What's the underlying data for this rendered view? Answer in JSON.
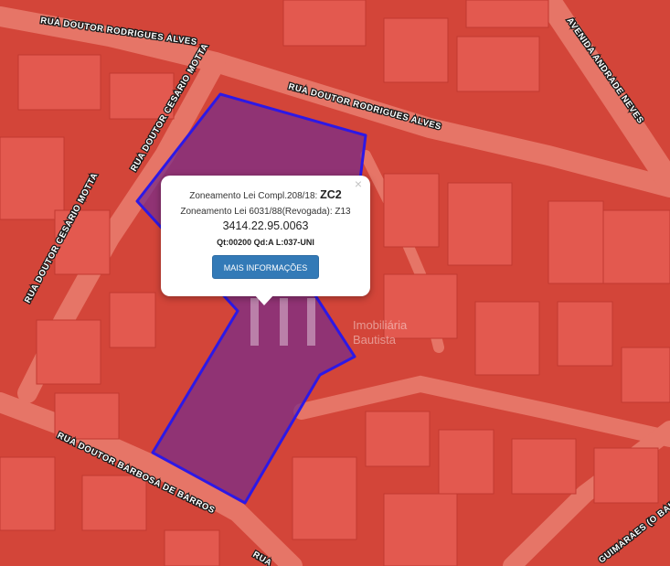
{
  "map": {
    "tint_color": "#e0382e",
    "parcel_outline_color": "#2d18e6",
    "parcel_fill_color": "#7a2e88",
    "streets": [
      "RUA DOUTOR RODRIGUES ALVES",
      "RUA DOUTOR RODRIGUES ALVES",
      "RUA DOUTOR CESARIO MOTTA",
      "RUA DOUTOR CESARIO MOTTA",
      "AVENIDA ANDRADE NEVES",
      "RUA DOUTOR BARBOSA DE BARROS",
      "RUA",
      "GUIMARAES (O BAHIA)"
    ]
  },
  "popup": {
    "close_icon": "×",
    "zoning_label": "Zoneamento Lei Compl.208/18:",
    "zoning_value": "ZC2",
    "old_zoning": "Zoneamento Lei 6031/88(Revogada): Z13",
    "parcel_code": "3414.22.95.0063",
    "block_info": "Qt:00200 Qd:A L:037-UNI",
    "button_label": "MAIS INFORMAÇÕES"
  },
  "watermark": {
    "line1": "Imobiliária",
    "line2": "Bautista"
  }
}
